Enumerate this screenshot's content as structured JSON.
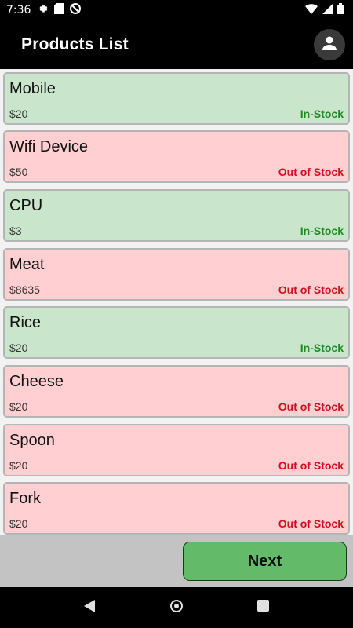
{
  "status_bar": {
    "time": "7:36",
    "icons": [
      "gear-icon",
      "sd-card-icon",
      "no-sync-icon",
      "wifi-icon",
      "signal-icon",
      "battery-icon"
    ]
  },
  "app_bar": {
    "title": "Products List",
    "account_icon": "account-circle-icon"
  },
  "colors": {
    "in_stock_bg": "#c9e6cc",
    "out_of_stock_bg": "#ffcfd2",
    "in_stock_text": "#1f8a24",
    "out_of_stock_text": "#d0101c",
    "next_button": "#63bb6a"
  },
  "products": [
    {
      "name": "Mobile",
      "price": "$20",
      "status": "In-Stock",
      "in_stock": true
    },
    {
      "name": "Wifi Device",
      "price": "$50",
      "status": "Out of Stock",
      "in_stock": false
    },
    {
      "name": "CPU",
      "price": "$3",
      "status": "In-Stock",
      "in_stock": true
    },
    {
      "name": "Meat",
      "price": "$8635",
      "status": "Out of Stock",
      "in_stock": false
    },
    {
      "name": "Rice",
      "price": "$20",
      "status": "In-Stock",
      "in_stock": true
    },
    {
      "name": "Cheese",
      "price": "$20",
      "status": "Out of Stock",
      "in_stock": false
    },
    {
      "name": "Spoon",
      "price": "$20",
      "status": "Out of Stock",
      "in_stock": false
    },
    {
      "name": "Fork",
      "price": "$20",
      "status": "Out of Stock",
      "in_stock": false
    }
  ],
  "footer": {
    "next_label": "Next"
  },
  "nav_bar": {
    "icons": [
      "back-icon",
      "home-icon",
      "recents-icon"
    ]
  }
}
